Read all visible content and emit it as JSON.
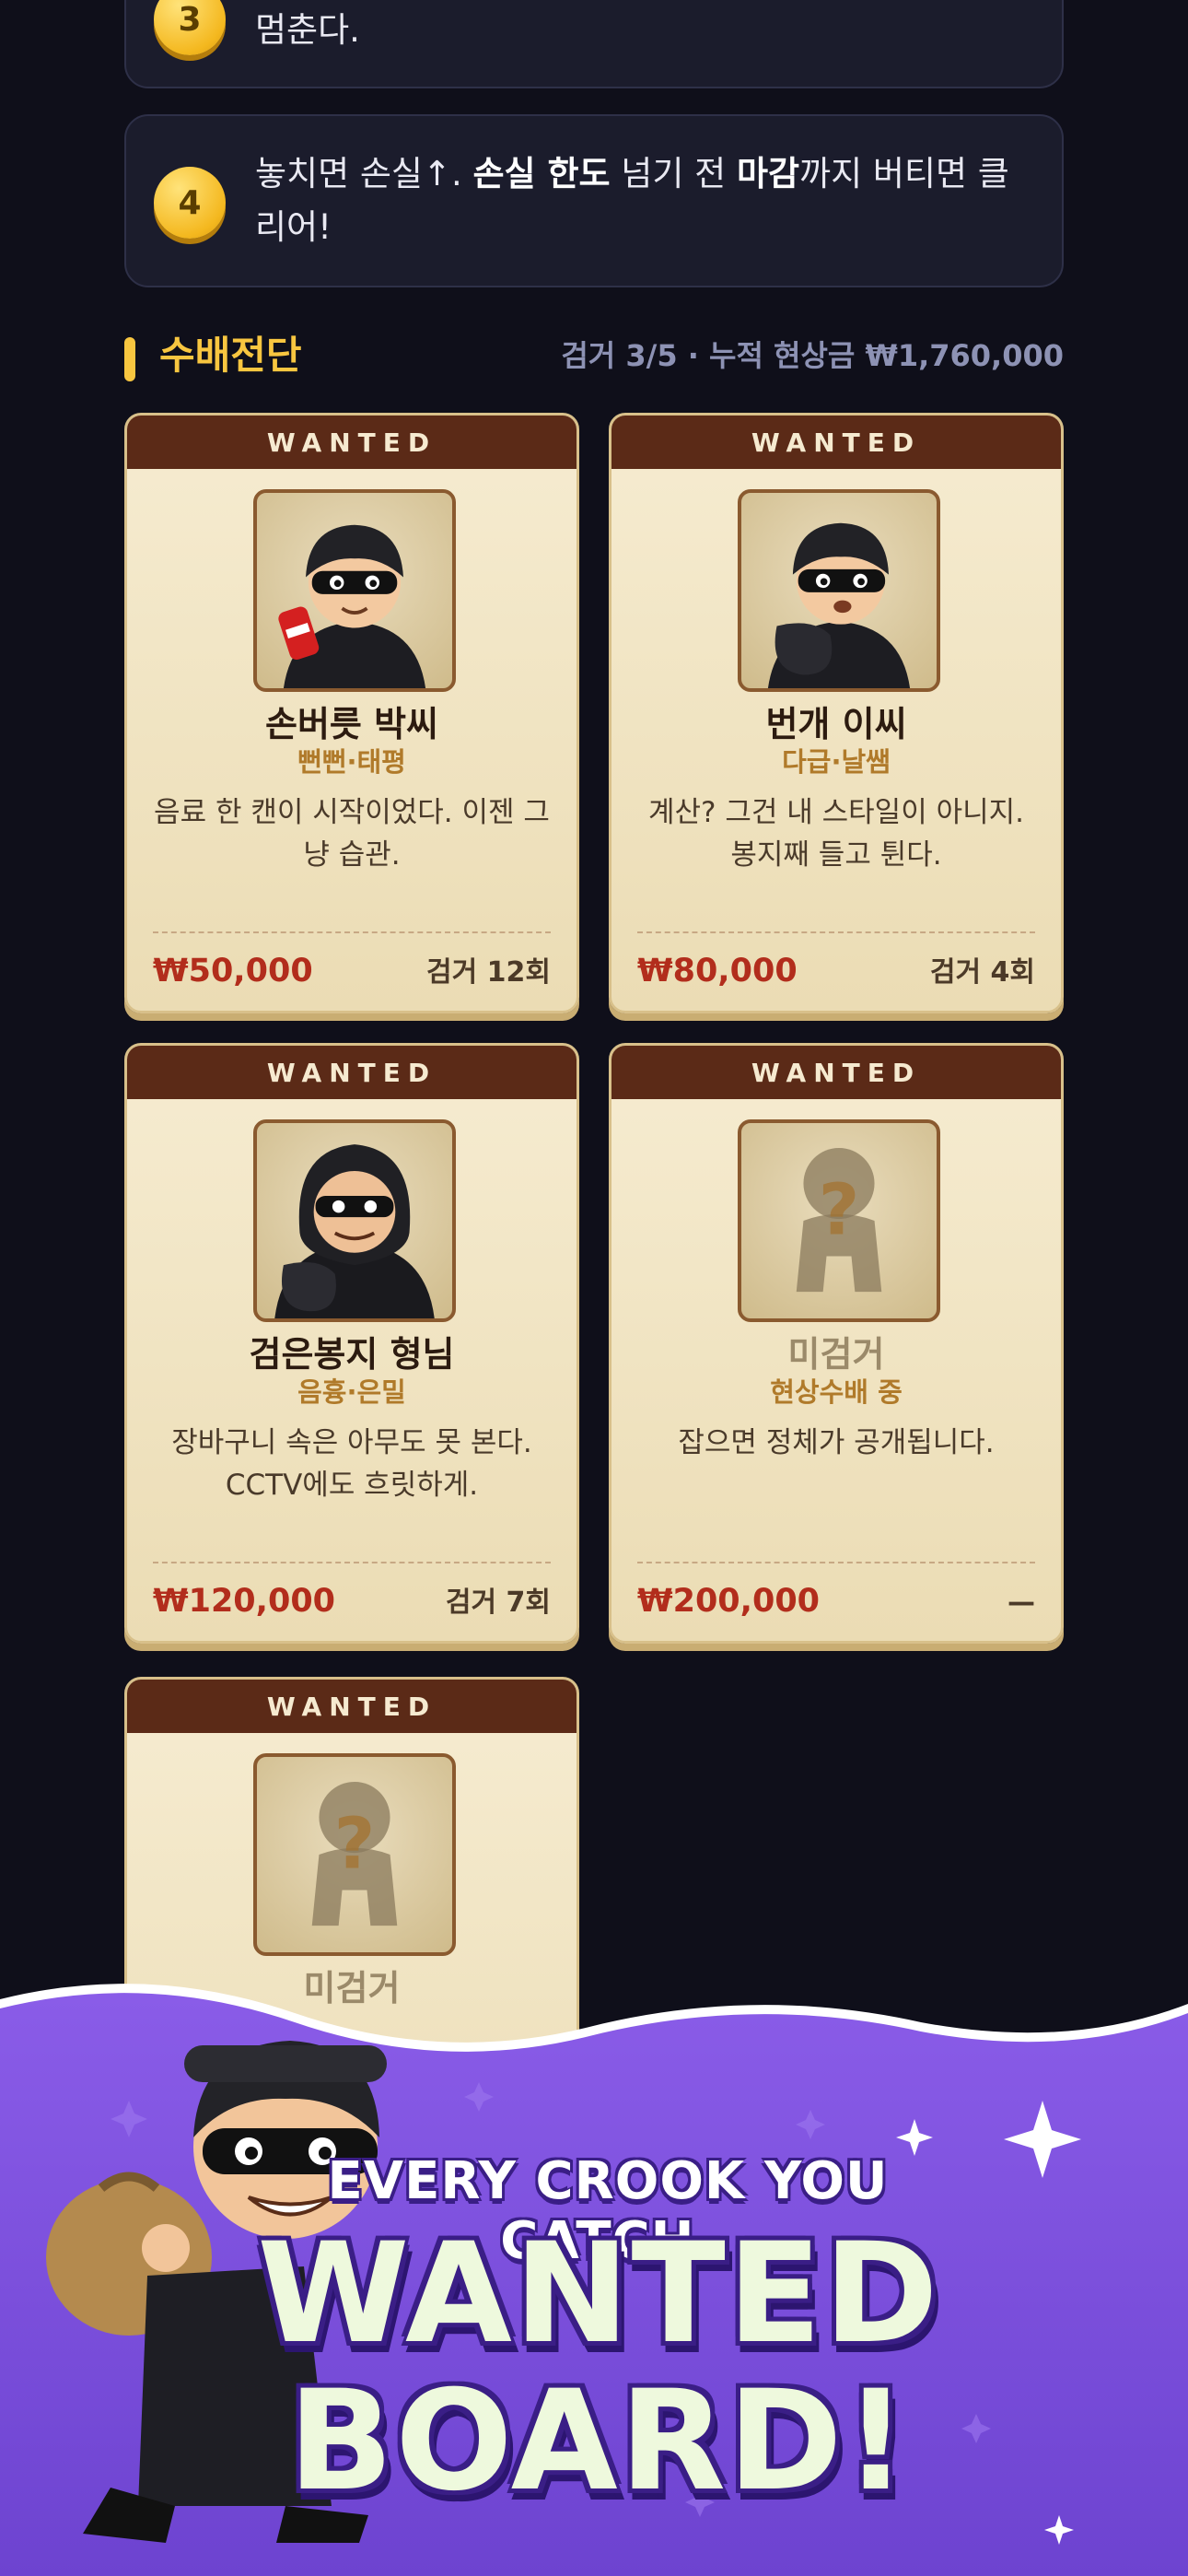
{
  "steps": [
    {
      "number": "3",
      "text_parts": [
        "멈춘다."
      ]
    },
    {
      "number": "4",
      "text_parts": [
        "놓치면 손실↑. ",
        "손실 한도",
        " 넘기 전 ",
        "마감",
        "까지 버티면 클리어!"
      ]
    }
  ],
  "section": {
    "title": "수배전단",
    "stats": "검거 3/5 · 누적 현상금 ₩1,760,000"
  },
  "wanted_label": "WANTED",
  "cards": [
    {
      "name": "손버릇 박씨",
      "traits": "뻔뻔·태평",
      "desc": "음료 한 캔이 시작이었다. 이젠 그냥 습관.",
      "bounty": "₩50,000",
      "catches": "검거 12회",
      "portrait": "thief-soda-can-icon"
    },
    {
      "name": "번개 이씨",
      "traits": "다급·날쌤",
      "desc": "계산? 그건 내 스타일이 아니지. 봉지째 들고 튄다.",
      "bounty": "₩80,000",
      "catches": "검거 4회",
      "portrait": "thief-bag-icon"
    },
    {
      "name": "검은봉지 형님",
      "traits": "음흉·은밀",
      "desc": "장바구니 속은 아무도 못 본다. CCTV에도 흐릿하게.",
      "bounty": "₩120,000",
      "catches": "검거 7회",
      "portrait": "thief-hooded-icon"
    },
    {
      "name": "미검거",
      "traits": "현상수배 중",
      "desc": "잡으면 정체가 공개됩니다.",
      "bounty": "₩200,000",
      "catches": "—",
      "portrait": "unknown-silhouette-icon"
    },
    {
      "name": "미검거",
      "traits": "",
      "desc": "",
      "bounty": "",
      "catches": "",
      "portrait": "unknown-silhouette-icon"
    }
  ],
  "banner": {
    "subtitle": "EVERY CROOK YOU CATCH,",
    "title": "WANTED BOARD!"
  },
  "colors": {
    "background": "#0f0f1a",
    "accent": "#f8c640",
    "bounty": "#b22d1c",
    "ribbon": "#5b2a17",
    "banner": "#7b4fdc"
  }
}
